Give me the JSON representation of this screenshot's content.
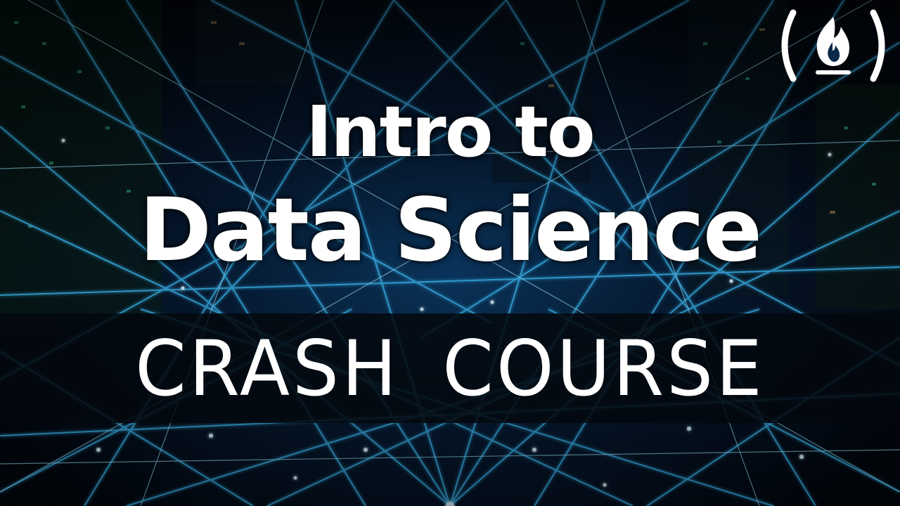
{
  "title": {
    "line1": "Intro to",
    "line2": "Data Science"
  },
  "banner": {
    "text": "CRASH COURSE"
  },
  "logo": {
    "icon": "freecodecamp-fire-icon"
  },
  "background": {
    "description_icon": "network-lines-image",
    "accent_color": "#39b6ff"
  }
}
